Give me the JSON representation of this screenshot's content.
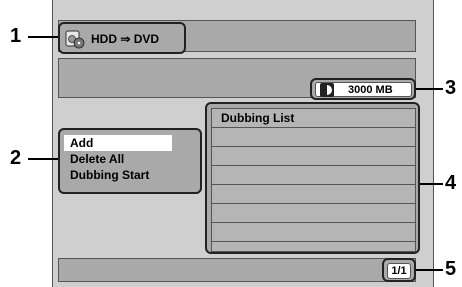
{
  "header": {
    "title": "HDD ⇒ DVD",
    "icon": "hdd-to-dvd-icon"
  },
  "capacity": {
    "value": "3000 MB",
    "icon": "disc-half-icon"
  },
  "menu": {
    "items": [
      {
        "label": "Add",
        "selected": true
      },
      {
        "label": "Delete All",
        "selected": false
      },
      {
        "label": "Dubbing Start",
        "selected": false
      }
    ]
  },
  "dubbing_list": {
    "header": "Dubbing List",
    "rows": [
      "",
      "",
      "",
      "",
      "",
      "",
      ""
    ]
  },
  "pagination": {
    "page": "1/1"
  },
  "callouts": [
    "1",
    "2",
    "3",
    "4",
    "5"
  ]
}
